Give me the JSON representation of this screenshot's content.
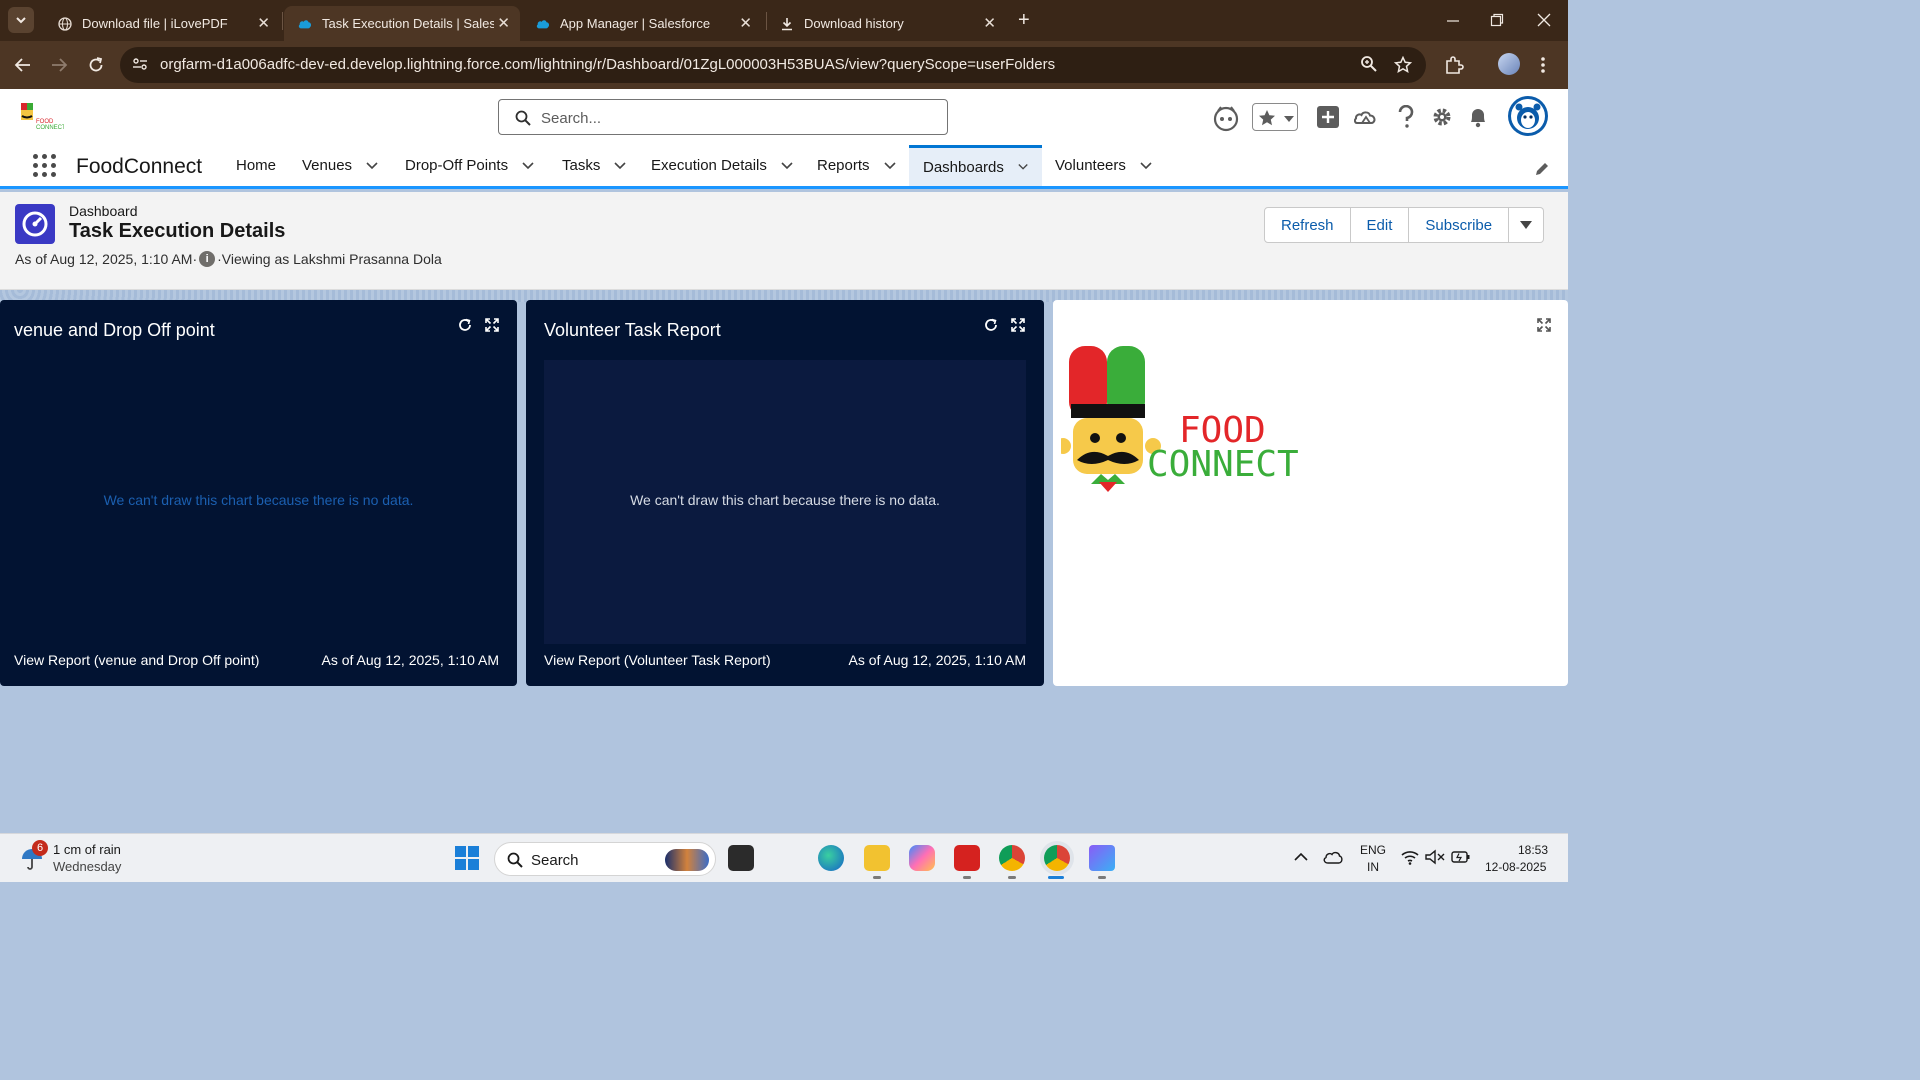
{
  "browser": {
    "tabs": [
      {
        "title": "Download file | iLovePDF",
        "icon": "globe-icon",
        "active": false
      },
      {
        "title": "Task Execution Details | Salesfor",
        "icon": "salesforce-cloud-icon",
        "active": true
      },
      {
        "title": "App Manager | Salesforce",
        "icon": "salesforce-cloud-icon",
        "active": false
      },
      {
        "title": "Download history",
        "icon": "download-icon",
        "active": false
      }
    ],
    "close_glyph": "✕",
    "new_tab_glyph": "+",
    "url": "orgfarm-d1a006adfc-dev-ed.develop.lightning.force.com/lightning/r/Dashboard/01ZgL000003H53BUAS/view?queryScope=userFolders"
  },
  "sf": {
    "search_placeholder": "Search...",
    "app_name": "FoodConnect",
    "nav": [
      {
        "label": "Home",
        "has_menu": false,
        "active": false
      },
      {
        "label": "Venues",
        "has_menu": true,
        "active": false
      },
      {
        "label": "Drop-Off Points",
        "has_menu": true,
        "active": false
      },
      {
        "label": "Tasks",
        "has_menu": true,
        "active": false
      },
      {
        "label": "Execution Details",
        "has_menu": true,
        "active": false
      },
      {
        "label": "Reports",
        "has_menu": true,
        "active": false
      },
      {
        "label": "Dashboards",
        "has_menu": true,
        "active": true
      },
      {
        "label": "Volunteers",
        "has_menu": true,
        "active": false
      }
    ]
  },
  "page": {
    "object_label": "Dashboard",
    "title": "Task Execution Details",
    "as_of": "As of Aug 12, 2025, 1:10 AM·",
    "viewing_as": "·Viewing as Lakshmi Prasanna Dola",
    "buttons": {
      "refresh": "Refresh",
      "edit": "Edit",
      "subscribe": "Subscribe"
    }
  },
  "widgets": [
    {
      "title": "venue and Drop Off point",
      "empty_message": "We can't draw this chart because there is no data.",
      "view_report": "View Report (venue and Drop Off point)",
      "as_of": "As of Aug 12, 2025, 1:10 AM"
    },
    {
      "title": "Volunteer Task Report",
      "empty_message": "We can't draw this chart because there is no data.",
      "view_report": "View Report (Volunteer Task Report)",
      "as_of": "As of Aug 12, 2025, 1:10 AM"
    }
  ],
  "image_widget": {
    "logo_line1": "FOOD",
    "logo_line2": "CONNECT"
  },
  "taskbar": {
    "weather_badge": "6",
    "weather_line1": "1 cm of rain",
    "weather_line2": "Wednesday",
    "search_label": "Search",
    "lang_line1": "ENG",
    "lang_line2": "IN",
    "time": "18:53",
    "date": "12-08-2025"
  },
  "colors": {
    "accent_blue": "#0176d3",
    "widget_dark": "#021332",
    "canvas": "#b0c4de",
    "empty_msg_blue": "#1b5fb0"
  }
}
